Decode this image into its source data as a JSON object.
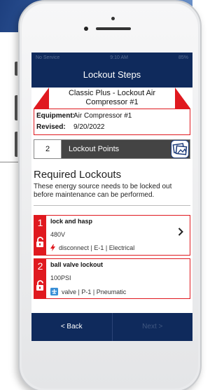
{
  "status_bar": {
    "carrier": "No Service",
    "time": "9:10 AM",
    "battery": "85%"
  },
  "nav": {
    "title": "Lockout Steps"
  },
  "equipment_card": {
    "title": "Classic Plus - Lockout Air Compressor #1",
    "equipment_label": "Equipment:",
    "equipment_value": "Air Compressor #1",
    "revised_label": "Revised:",
    "revised_value": "9/20/2022"
  },
  "points": {
    "count": "2",
    "label": "Lockout Points"
  },
  "section": {
    "title": "Required Lockouts",
    "description": "These energy source needs to be locked out before maintenance can be performed."
  },
  "lockouts": [
    {
      "number": "1",
      "name": "lock and hasp",
      "value": "480V",
      "meta": "disconnect | E-1 | Electrical",
      "icon": "lightning-icon"
    },
    {
      "number": "2",
      "name": "ball valve lockout",
      "value": "100PSI",
      "meta": "valve | P-1 | Pneumatic",
      "icon": "valve-icon"
    }
  ],
  "footer": {
    "back": "< Back",
    "next": "Next >"
  },
  "colors": {
    "navy": "#0f2a5c",
    "red": "#e0191f"
  }
}
